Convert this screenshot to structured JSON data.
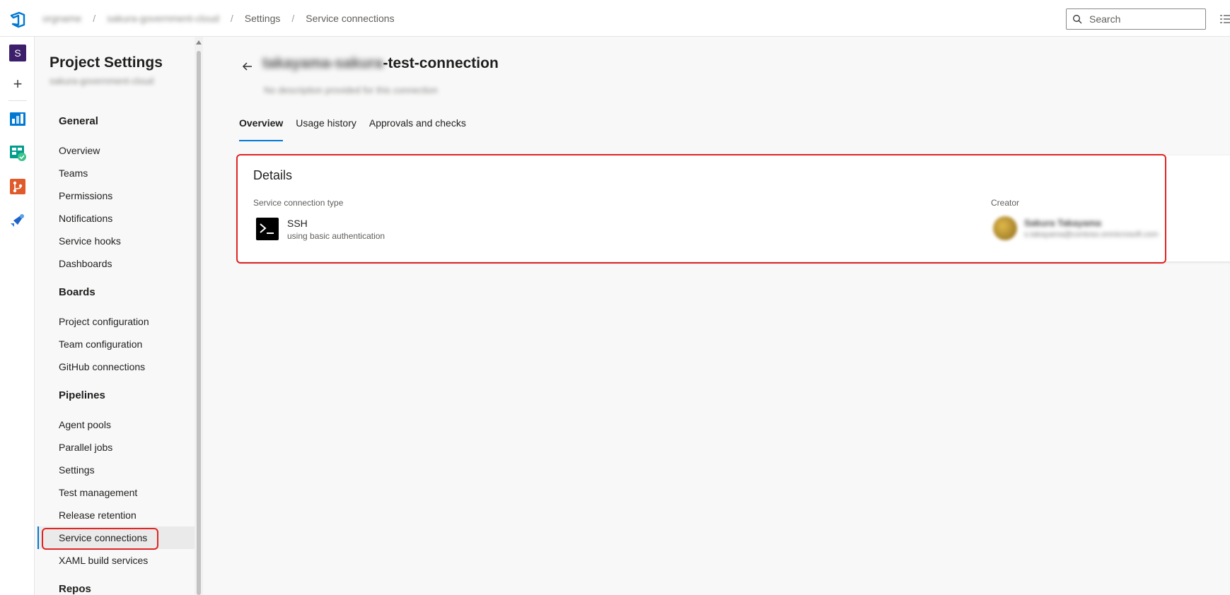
{
  "header": {
    "breadcrumbs": [
      {
        "label": "orgname",
        "blurred": true
      },
      {
        "label": "sakura-government-cloud",
        "blurred": true
      },
      {
        "label": "Settings",
        "blurred": false
      },
      {
        "label": "Service connections",
        "blurred": false
      }
    ],
    "search_placeholder": "Search"
  },
  "rail": {
    "project_initial": "S",
    "apps": [
      "overview-icon",
      "boards-icon",
      "repos-icon",
      "pipelines-icon"
    ]
  },
  "nav": {
    "title": "Project Settings",
    "project_name": "sakura-government-cloud",
    "sections": [
      {
        "label": "General",
        "items": [
          "Overview",
          "Teams",
          "Permissions",
          "Notifications",
          "Service hooks",
          "Dashboards"
        ]
      },
      {
        "label": "Boards",
        "items": [
          "Project configuration",
          "Team configuration",
          "GitHub connections"
        ]
      },
      {
        "label": "Pipelines",
        "items": [
          "Agent pools",
          "Parallel jobs",
          "Settings",
          "Test management",
          "Release retention",
          "Service connections",
          "XAML build services"
        ]
      },
      {
        "label": "Repos",
        "items": []
      }
    ],
    "selected_item": "Service connections"
  },
  "page": {
    "title_prefix_blurred": "takayama-sakura",
    "title_suffix": "-test-connection",
    "subtitle": "No description provided for this connection",
    "tabs": [
      "Overview",
      "Usage history",
      "Approvals and checks"
    ],
    "active_tab": "Overview"
  },
  "details": {
    "title": "Details",
    "type_label": "Service connection type",
    "type_name": "SSH",
    "type_auth": "using basic authentication",
    "creator_label": "Creator",
    "creator_name": "Sakura Takayama",
    "creator_email": "s.takayama@contoso.onmicrosoft.com"
  },
  "colors": {
    "accent": "#0078d4",
    "highlight": "#e02424",
    "project_tile": "#3b1f6b"
  }
}
